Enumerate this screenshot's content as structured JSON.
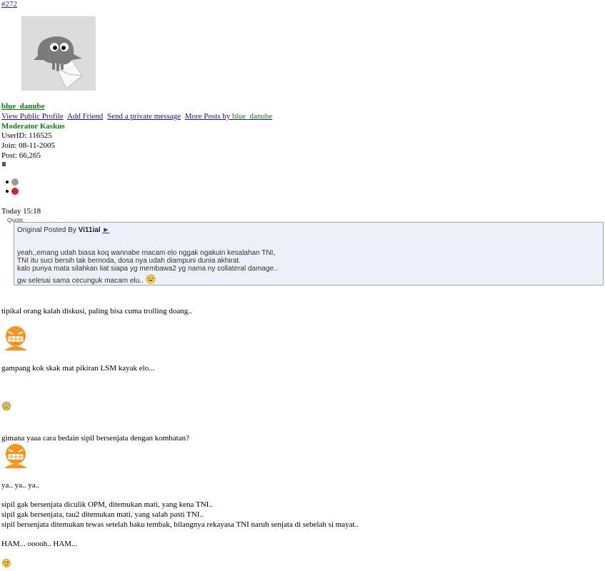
{
  "post": {
    "number": "#272",
    "username": "blue_danube",
    "links": [
      "View Public Profile",
      "Add Friend",
      "Send a private message",
      "More Posts by"
    ],
    "more_posts_user": "blue_danube",
    "user_title": "Moderator Kaskus",
    "user_id": "UserID: 116525",
    "join": "Join: 08-11-2005",
    "post_count": "Post: 66,265",
    "time": "Today 15:18"
  },
  "quote": {
    "label": "Quote:",
    "posted_by_prefix": "Original Posted By",
    "posted_by_user": "Vi11ial",
    "arrow": "►",
    "lines": [
      "yeah,,emang udah biasa koq wannabe macam elo nggak ngakuin kesalahan TNI,",
      "TNI itu suci bersih tak bernoda, dosa nya udah diampuni dunia akhirat.",
      "kalo punya mata silahkan liat siapa yg membawa2 yg nama ny collateral damage..",
      "gw selesai sama cecunguk macam elu.."
    ]
  },
  "body": {
    "line1": "tipikal orang kalah diskusi, paling bisa cuma trolling doang..",
    "line2": "gampang kok skak mat pikiran LSM kayak elo...",
    "line3": "gimana yaaa cara bedain sipil bersenjata dengan kombatan?",
    "line4": "ya.. ya.. ya..",
    "line5": "sipil gak bersenjata diculik OPM, ditemukan mati, yang kena TNI..",
    "line6": "sipil gak bersenjata, tau2 ditemukan mati, yang salah pasti TNI..",
    "line7": "sipil bersenjata ditemukan tewas setelah baku tembak, bilangnya rekayasa TNI naruh senjata di sebelah si mayat..",
    "line8": "HAM... ooooh.. HAM..."
  },
  "icons": {
    "avatar": "kaskus-default-avatar",
    "status_online": "offline-status-icon",
    "report": "report-post-icon",
    "smiley_grin": "grin-smiley-icon",
    "smiley_confused": "confused-smiley-icon",
    "smiley_quote": "laugh-smiley-icon",
    "smiley_wink": "wink-smiley-icon"
  },
  "colors": {
    "link": "#1a0dab",
    "username": "#0f7a0f",
    "quote_bg": "#eef0f8",
    "quote_border": "#9fa5c8",
    "smiley_orange": "#f7941d"
  }
}
